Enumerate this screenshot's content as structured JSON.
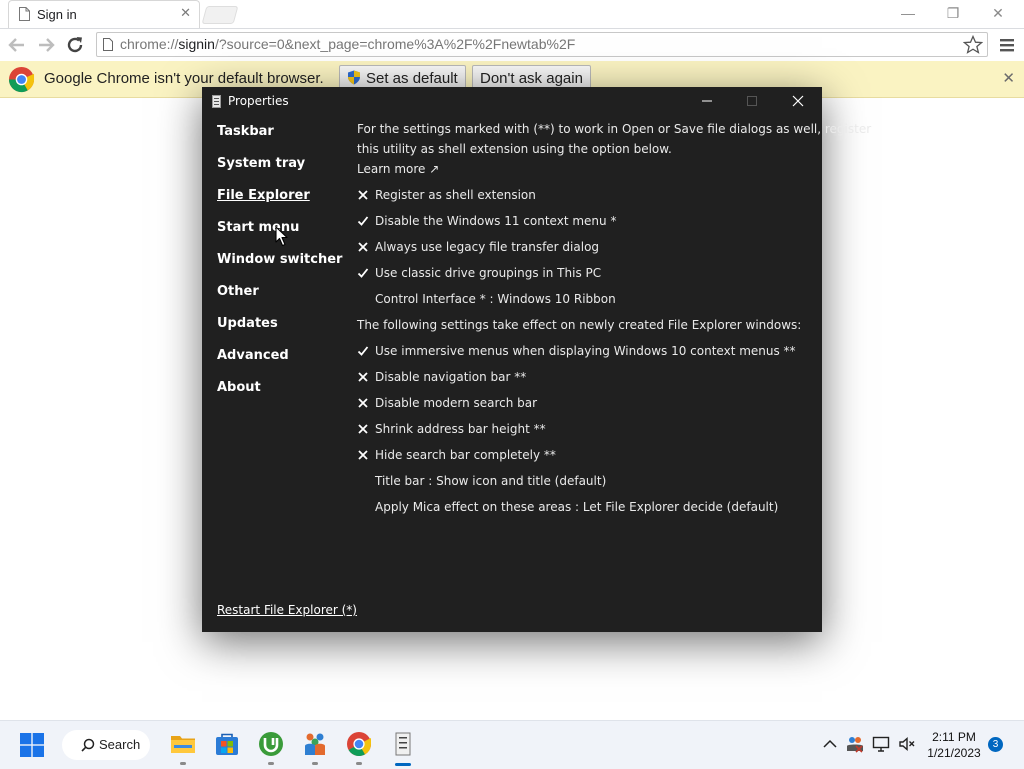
{
  "browser": {
    "tab": {
      "title": "Sign in",
      "close_glyph": "✕"
    },
    "window_controls": {
      "minimize": "—",
      "restore": "❐",
      "close": "✕"
    },
    "address": {
      "scheme": "chrome://",
      "host": "signin",
      "rest": "/?source=0&next_page=chrome%3A%2F%2Fnewtab%2F"
    },
    "infobar": {
      "message": "Google Chrome isn't your default browser.",
      "set_default_label": "Set as default",
      "dont_ask_label": "Don't ask again",
      "close_glyph": "✕"
    }
  },
  "dialog": {
    "title": "Properties",
    "nav": [
      {
        "label": "Taskbar"
      },
      {
        "label": "System tray"
      },
      {
        "label": "File Explorer",
        "selected": true
      },
      {
        "label": "Start menu"
      },
      {
        "label": "Window switcher"
      },
      {
        "label": "Other"
      },
      {
        "label": "Updates"
      },
      {
        "label": "Advanced"
      },
      {
        "label": "About"
      }
    ],
    "intro_line1": "For the settings marked with (**) to work in Open or Save file dialogs as well, register",
    "intro_line2": "this utility as shell extension using the option below.",
    "learn_more": "Learn more ↗",
    "options": [
      {
        "label": "Register as shell extension",
        "state": "off"
      },
      {
        "label": "Disable the Windows 11 context menu *",
        "state": "on"
      },
      {
        "label": "Always use legacy file transfer dialog",
        "state": "off"
      },
      {
        "label": "Use classic drive groupings in This PC",
        "state": "on"
      },
      {
        "label": "Control Interface * : Windows 10 Ribbon",
        "state": "none"
      }
    ],
    "section_heading": "The following settings take effect on newly created File Explorer windows:",
    "options2": [
      {
        "label": "Use immersive menus when displaying Windows 10 context menus **",
        "state": "on"
      },
      {
        "label": "Disable navigation bar **",
        "state": "off"
      },
      {
        "label": "Disable modern search bar",
        "state": "off"
      },
      {
        "label": "Shrink address bar height **",
        "state": "off"
      },
      {
        "label": "Hide search bar completely **",
        "state": "off"
      },
      {
        "label": "Title bar : Show icon and title (default)",
        "state": "none"
      },
      {
        "label": "Apply Mica effect on these areas : Let File Explorer decide (default)",
        "state": "none"
      }
    ],
    "restart_link": "Restart File Explorer (*)"
  },
  "taskbar": {
    "search_label": "Search",
    "clock_time": "2:11 PM",
    "clock_date": "1/21/2023",
    "notification_count": "3",
    "apps": [
      "file-explorer",
      "microsoft-store",
      "utorrent",
      "people",
      "chrome",
      "properties-app"
    ]
  },
  "colors": {
    "dialog_bg": "#202020",
    "infobar_bg": "#faf3c2",
    "taskbar_bg": "#f0f3f9",
    "accent": "#0067c0"
  }
}
